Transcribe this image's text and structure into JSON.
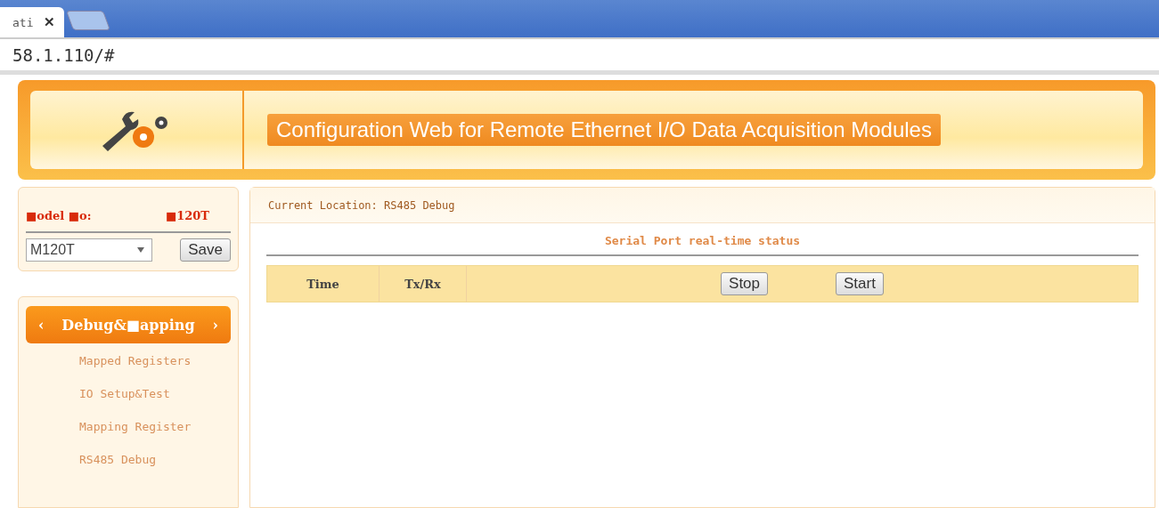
{
  "browser": {
    "tab_title": "ati",
    "tab_close": "✕",
    "address": "58.1.110/#"
  },
  "header": {
    "title": "Configuration Web for Remote Ethernet I/O Data Acquisition Modules"
  },
  "model": {
    "label": "■odel ■o:",
    "value": "■120T",
    "select_value": "M120T",
    "save": "Save"
  },
  "menu": {
    "title": "Debug&■apping",
    "prev": "‹",
    "next": "›",
    "items": [
      {
        "label": "Mapped Registers"
      },
      {
        "label": "IO Setup&Test"
      },
      {
        "label": "Mapping Register"
      },
      {
        "label": "RS485 Debug"
      }
    ]
  },
  "main": {
    "location": "Current Location: RS485 Debug",
    "section_title": "Serial Port real-time status",
    "table": {
      "columns": [
        "Time",
        "Tx/Rx"
      ],
      "buttons": [
        "Stop",
        "Start"
      ]
    }
  }
}
